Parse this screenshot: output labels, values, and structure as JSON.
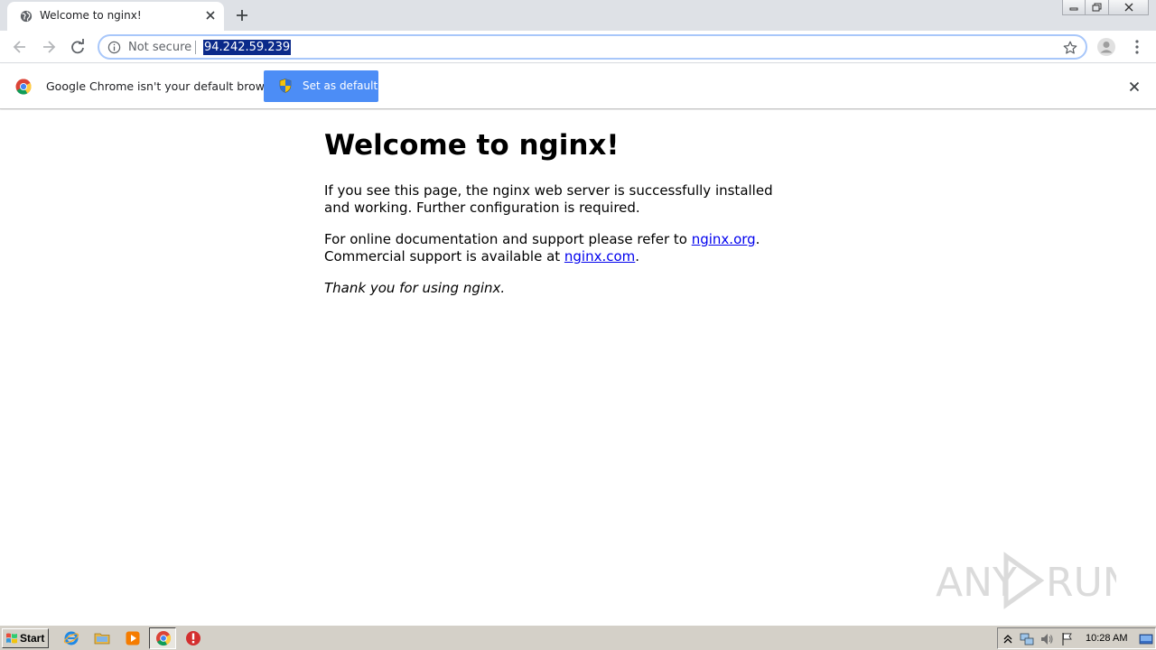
{
  "browser": {
    "tab": {
      "title": "Welcome to nginx!",
      "favicon": "globe-icon"
    },
    "window_controls": [
      "minimize-icon",
      "restore-icon",
      "close-icon"
    ],
    "toolbar": {
      "security_label": "Not secure",
      "url": "94.242.59.239"
    },
    "infobar": {
      "message": "Google Chrome isn't your default browser",
      "button_label": "Set as default"
    }
  },
  "page": {
    "heading": "Welcome to nginx!",
    "paragraph1": "If you see this page, the nginx web server is successfully installed and working. Further configuration is required.",
    "paragraph2_prefix": "For online documentation and support please refer to ",
    "link1": "nginx.org",
    "paragraph2_mid": ".",
    "paragraph2_line2_prefix": "Commercial support is available at ",
    "link2": "nginx.com",
    "paragraph2_suffix": ".",
    "thanks": "Thank you for using nginx."
  },
  "watermark": {
    "text": "ANY RUN"
  },
  "taskbar": {
    "start_label": "Start",
    "pinned": [
      "internet-explorer-icon",
      "folder-icon",
      "media-player-icon",
      "chrome-icon",
      "stop-sign-icon"
    ],
    "tray": [
      "expand-tray-icon",
      "network-icon",
      "volume-icon",
      "flag-icon",
      "show-desktop-icon"
    ],
    "clock": "10:28 AM"
  },
  "colors": {
    "tabstrip": "#dee1e6",
    "button_blue": "#4c8df6",
    "url_highlight": "#0b2a8a",
    "link": "#0000ee",
    "taskbar": "#d4d0c8"
  }
}
